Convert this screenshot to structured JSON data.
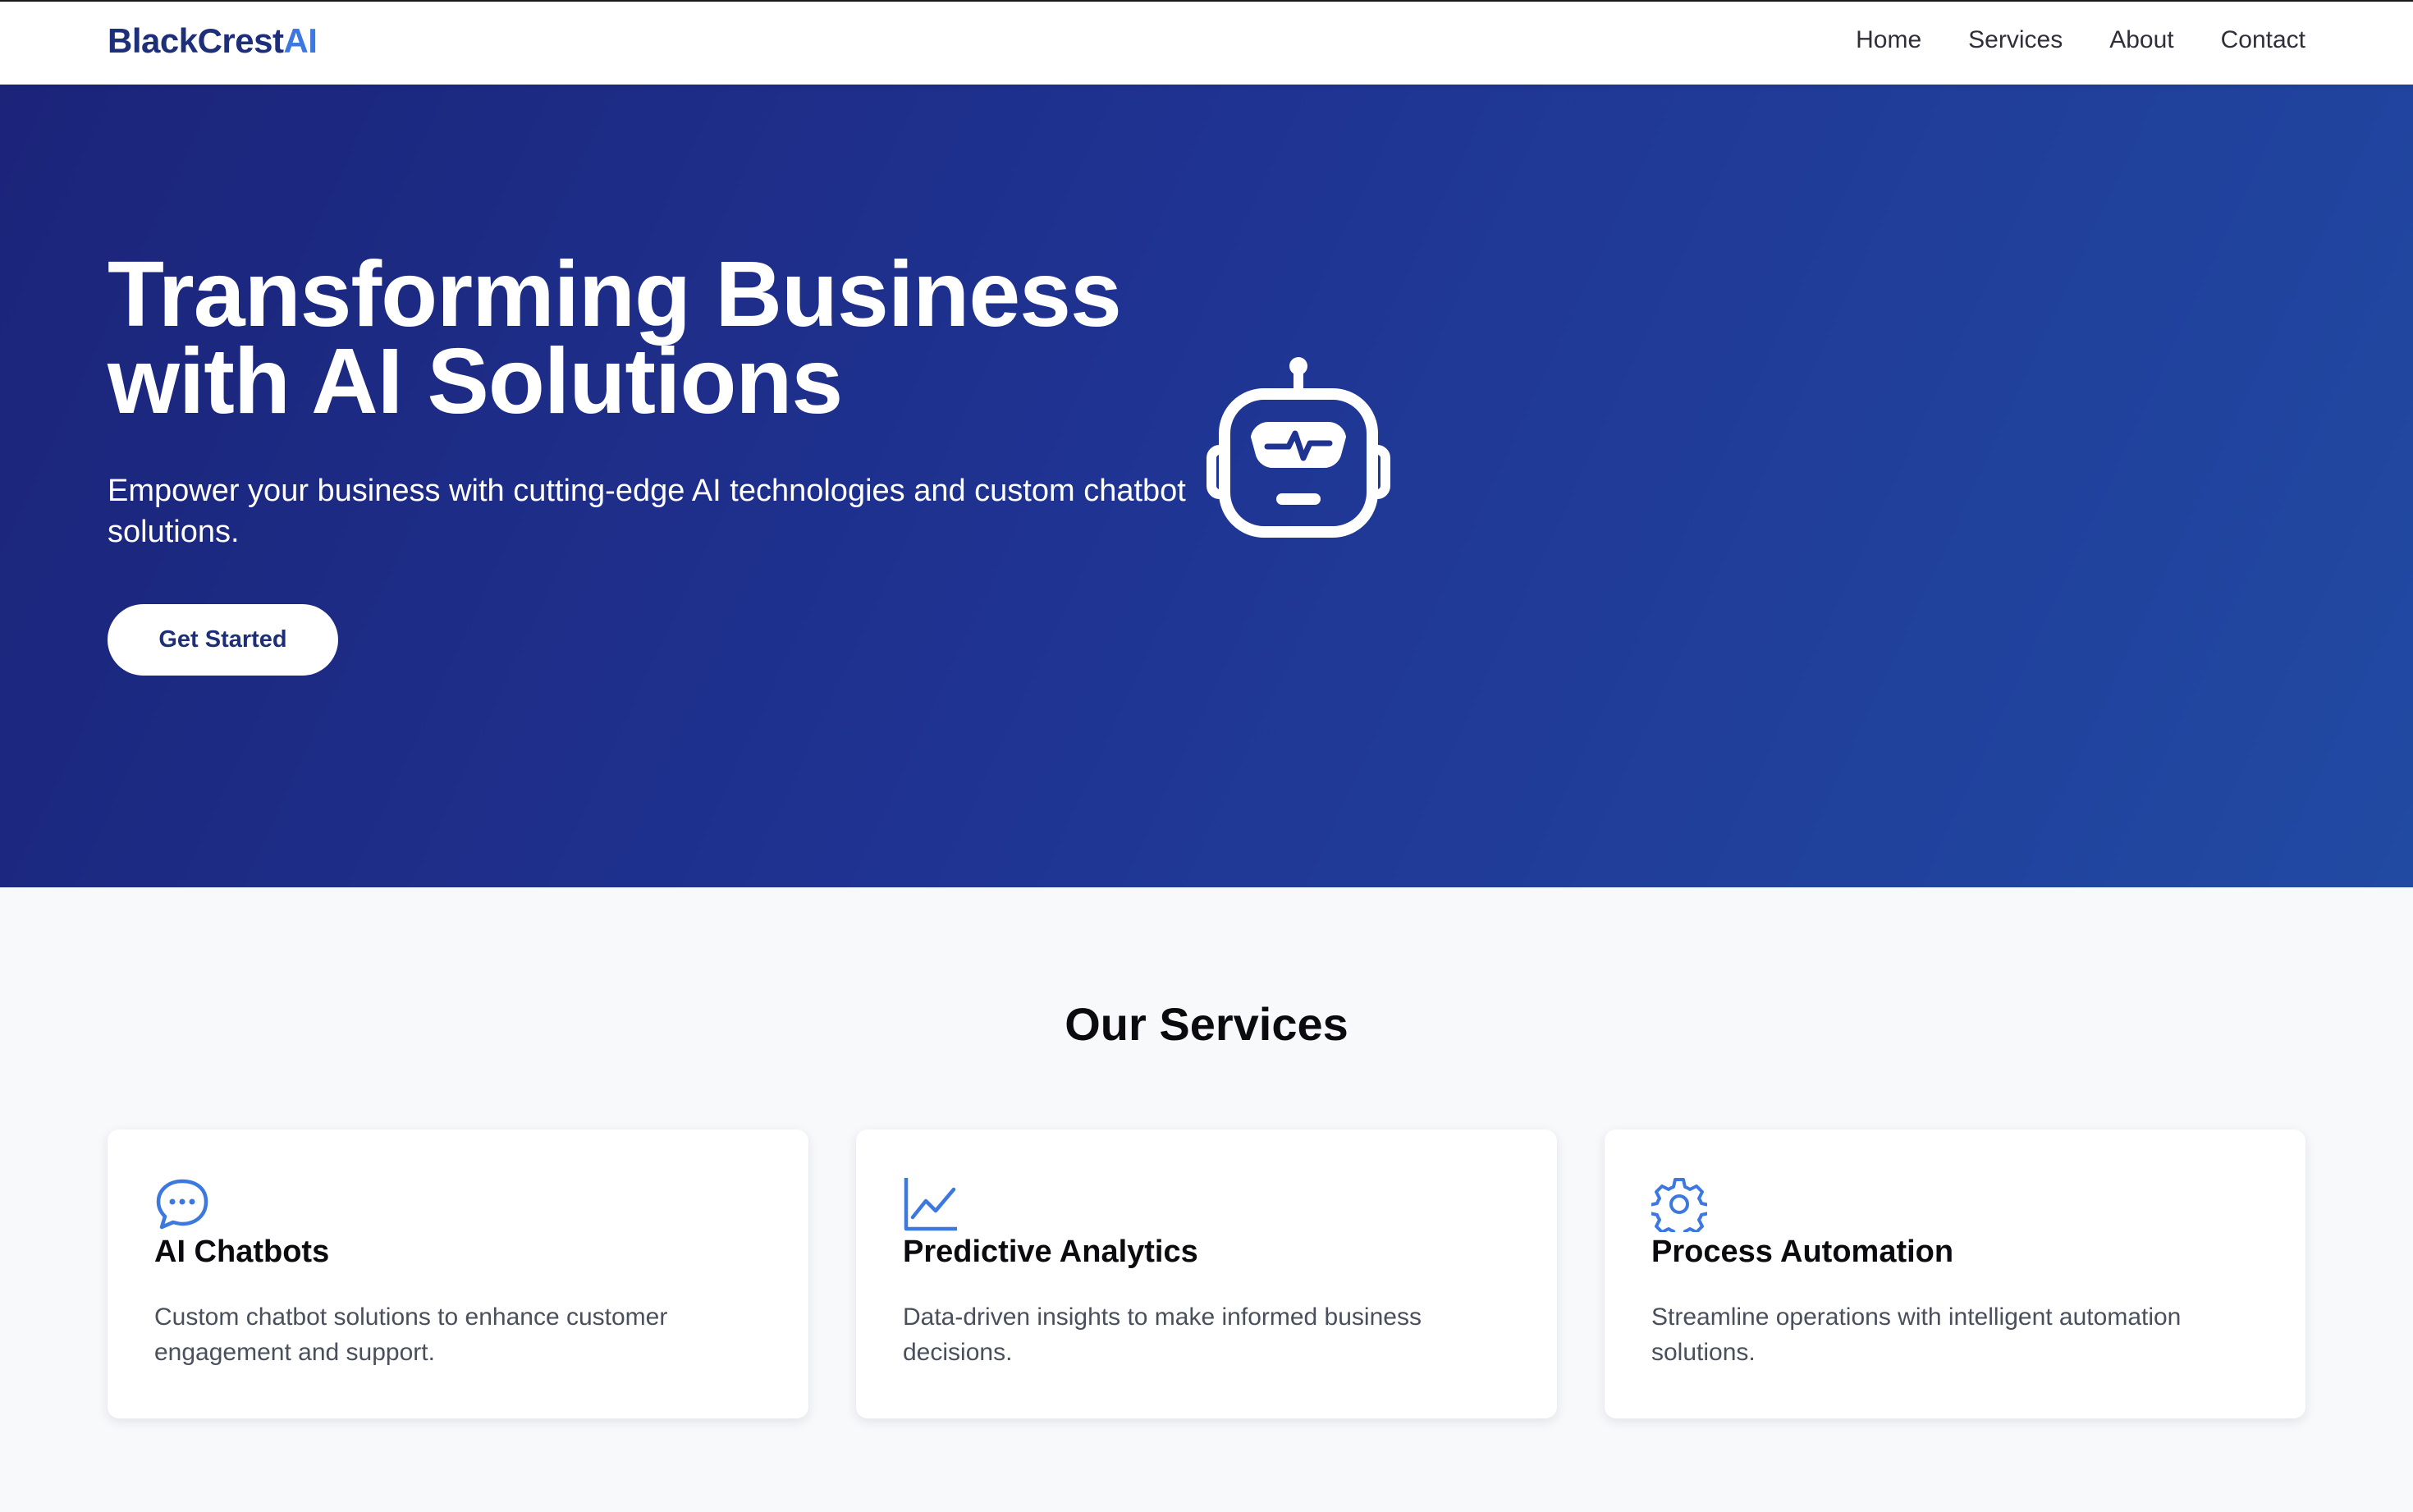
{
  "brand": {
    "name": "BlackCrest",
    "accent": "AI",
    "color": "#1e2f7a",
    "accent_color": "#3d77e0"
  },
  "nav": {
    "links": [
      {
        "label": "Home"
      },
      {
        "label": "Services"
      },
      {
        "label": "About"
      },
      {
        "label": "Contact"
      }
    ]
  },
  "hero": {
    "title_line1": "Transforming Business",
    "title_line2": "with AI Solutions",
    "subtitle": "Empower your business with cutting-edge AI technologies and custom chatbot solutions.",
    "cta_label": "Get Started",
    "icon": "robot-icon",
    "gradient_start": "#1b2479",
    "gradient_end": "#214aa3"
  },
  "services": {
    "heading": "Our Services",
    "items": [
      {
        "icon": "chat-bubble-icon",
        "title": "AI Chatbots",
        "description": "Custom chatbot solutions to enhance customer engagement and support."
      },
      {
        "icon": "line-chart-icon",
        "title": "Predictive Analytics",
        "description": "Data-driven insights to make informed business decisions."
      },
      {
        "icon": "gear-icon",
        "title": "Process Automation",
        "description": "Streamline operations with intelligent automation solutions."
      }
    ],
    "icon_color": "#3d77e0"
  }
}
